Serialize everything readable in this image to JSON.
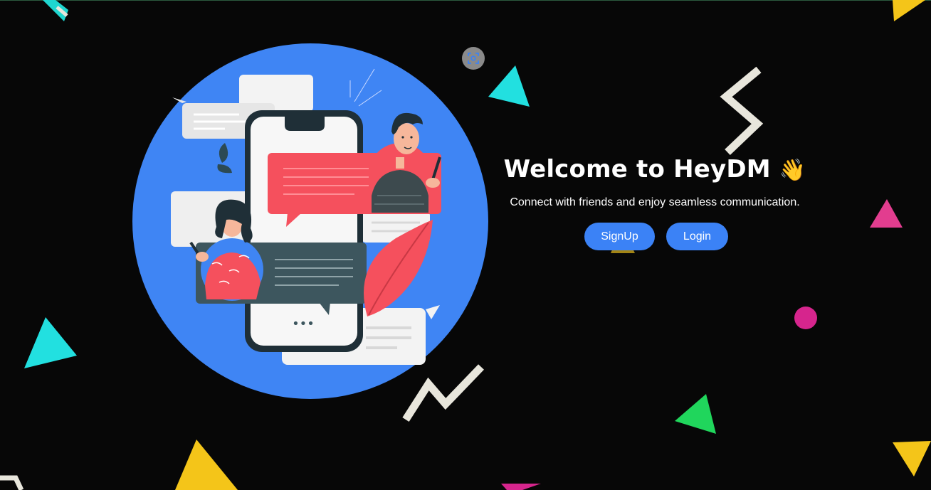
{
  "hero": {
    "title": "Welcome to HeyDM",
    "wave_emoji": "👋",
    "subtitle": "Connect with friends and enjoy seamless communication.",
    "signup_label": "SignUp",
    "login_label": "Login"
  },
  "illustration": {
    "dots": "•••"
  },
  "colors": {
    "accent": "#3b82f6",
    "background": "#070707",
    "bubble_red": "#f5505d",
    "bubble_dark": "#3d565e"
  },
  "icons": {
    "scan": "scan-icon",
    "hand_wave": "waving-hand"
  }
}
